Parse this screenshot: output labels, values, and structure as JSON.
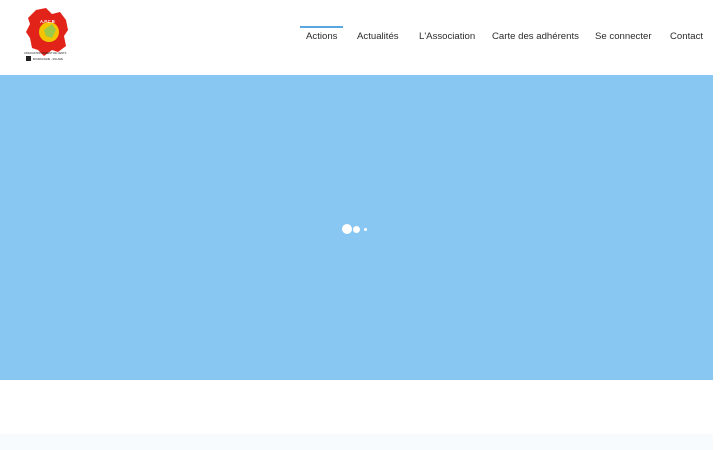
{
  "brand": {
    "logo_alt": "A.P.C.B",
    "logo_text_main": "A.P.C.B",
    "logo_text_sub": "ASSOCIATION PARENT DE CENTS",
    "logo_text_region": "BOURGOGNE · SOLANE",
    "colors": {
      "red": "#e2231a",
      "yellow": "#f5c400",
      "green": "#9cc94a",
      "dark": "#222222"
    }
  },
  "nav": {
    "items": [
      {
        "label": "Actions",
        "active": true
      },
      {
        "label": "Actualités",
        "active": false
      },
      {
        "label": "L'Association",
        "active": false
      },
      {
        "label": "Carte des adhérents",
        "active": false
      },
      {
        "label": "Se connecter",
        "active": false
      },
      {
        "label": "Contact",
        "active": false
      }
    ],
    "accent_color": "#5aa6e0"
  },
  "hero": {
    "background": "#87c7f1",
    "state": "loading"
  }
}
